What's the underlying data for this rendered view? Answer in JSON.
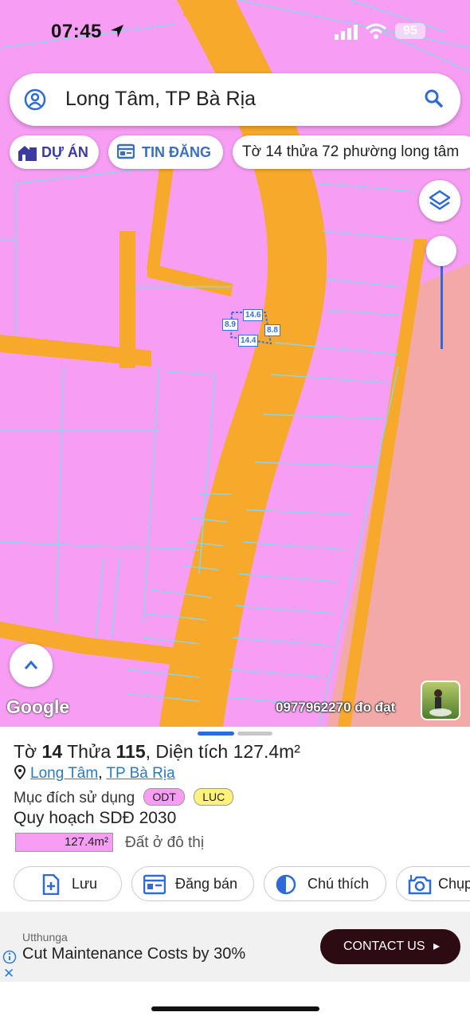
{
  "status": {
    "time": "07:45",
    "battery": "95"
  },
  "search": {
    "text": "Long Tâm, TP Bà Rịa"
  },
  "chips": {
    "du_an": "DỰ ÁN",
    "tin_dang": "TIN ĐĂNG",
    "history": "Tờ 14 thửa 72 phường long tâm"
  },
  "map": {
    "google_label": "Google",
    "phone_note": "0977962270 đo đạt",
    "dims": [
      "14.6",
      "8.9",
      "8.8",
      "14.4"
    ],
    "colors": {
      "residential": "#f79ef4",
      "road": "#f6a92a",
      "agri": "#f4a9a9",
      "parcel_line": "#8fd4e6"
    }
  },
  "sheet": {
    "title_pre": "Tờ ",
    "sheet_no": "14",
    "title_mid": " Thửa ",
    "parcel_no": "115",
    "title_post": ", Diện tích 127.4m²",
    "ward": "Long Tâm",
    "sep": ", ",
    "city": "TP Bà Rịa",
    "purpose_label": "Mục đích sử dụng",
    "tags": [
      "ODT",
      "LUC"
    ],
    "plan": "Quy hoạch SDĐ 2030",
    "area_value": "127.4m²",
    "area_label": "Đất ở đô thị",
    "actions": [
      "Lưu",
      "Đăng bán",
      "Chú thích",
      "Chụp"
    ]
  },
  "ad": {
    "brand": "Utthunga",
    "headline": "Cut Maintenance Costs by 30%",
    "cta": "CONTACT US",
    "close": "✕"
  }
}
